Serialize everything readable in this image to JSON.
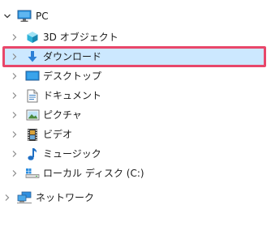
{
  "tree": {
    "root": {
      "label": "PC",
      "icon": "pc-monitor-icon",
      "expanded": true
    },
    "children": [
      {
        "label": "3D オブジェクト",
        "icon": "3d-objects-icon"
      },
      {
        "label": "ダウンロード",
        "icon": "download-arrow-icon",
        "selected": true
      },
      {
        "label": "デスクトップ",
        "icon": "desktop-icon"
      },
      {
        "label": "ドキュメント",
        "icon": "documents-icon"
      },
      {
        "label": "ピクチャ",
        "icon": "pictures-icon"
      },
      {
        "label": "ビデオ",
        "icon": "video-icon"
      },
      {
        "label": "ミュージック",
        "icon": "music-note-icon"
      },
      {
        "label": "ローカル ディスク (C:)",
        "icon": "local-disk-icon"
      }
    ],
    "network": {
      "label": "ネットワーク",
      "icon": "network-icon"
    }
  },
  "colors": {
    "selection": "#cce8ff",
    "highlight_border": "#e8476a",
    "chevron": "#8a8a8a"
  }
}
